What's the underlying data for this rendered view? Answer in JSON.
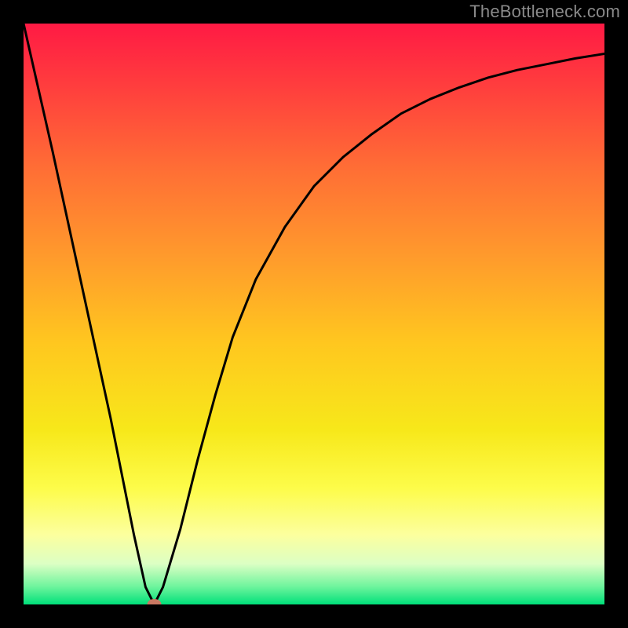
{
  "watermark": "TheBottleneck.com",
  "chart_data": {
    "type": "line",
    "title": "",
    "xlabel": "",
    "ylabel": "",
    "xlim": [
      0,
      100
    ],
    "ylim": [
      0,
      100
    ],
    "background_gradient": {
      "stops": [
        {
          "offset": 0.0,
          "color": "#ff1a44"
        },
        {
          "offset": 0.1,
          "color": "#ff3b3e"
        },
        {
          "offset": 0.25,
          "color": "#ff6e35"
        },
        {
          "offset": 0.4,
          "color": "#ff9a2c"
        },
        {
          "offset": 0.55,
          "color": "#ffc71f"
        },
        {
          "offset": 0.7,
          "color": "#f7e81a"
        },
        {
          "offset": 0.8,
          "color": "#fdfc4a"
        },
        {
          "offset": 0.88,
          "color": "#fcff9e"
        },
        {
          "offset": 0.93,
          "color": "#dcffc4"
        },
        {
          "offset": 0.97,
          "color": "#6cf49c"
        },
        {
          "offset": 1.0,
          "color": "#00e07a"
        }
      ]
    },
    "series": [
      {
        "name": "bottleneck-curve",
        "type": "line",
        "x": [
          0,
          5,
          10,
          15,
          19,
          21,
          22.5,
          24,
          27,
          30,
          33,
          36,
          40,
          45,
          50,
          55,
          60,
          65,
          70,
          75,
          80,
          85,
          90,
          95,
          100
        ],
        "values": [
          100,
          78,
          55,
          32,
          12,
          3,
          0,
          3,
          13,
          25,
          36,
          46,
          56,
          65,
          72,
          77,
          81,
          84.5,
          87,
          89,
          90.7,
          92,
          93,
          94,
          94.8
        ]
      }
    ],
    "marker": {
      "x": 22.5,
      "y": 0,
      "color": "#c97862",
      "radius": 8
    }
  }
}
